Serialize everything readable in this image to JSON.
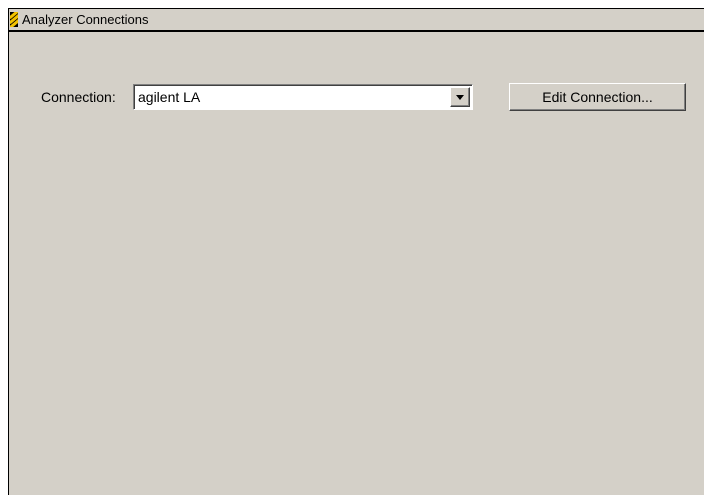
{
  "panel": {
    "title": "Analyzer Connections",
    "icon": "analyzer-logo-icon"
  },
  "connection": {
    "label": "Connection:",
    "selected_value": "agilent LA"
  },
  "buttons": {
    "edit_connection": "Edit Connection..."
  },
  "colors": {
    "panel_background": "#d4d0c8",
    "icon_stripe": "#f2c200"
  }
}
